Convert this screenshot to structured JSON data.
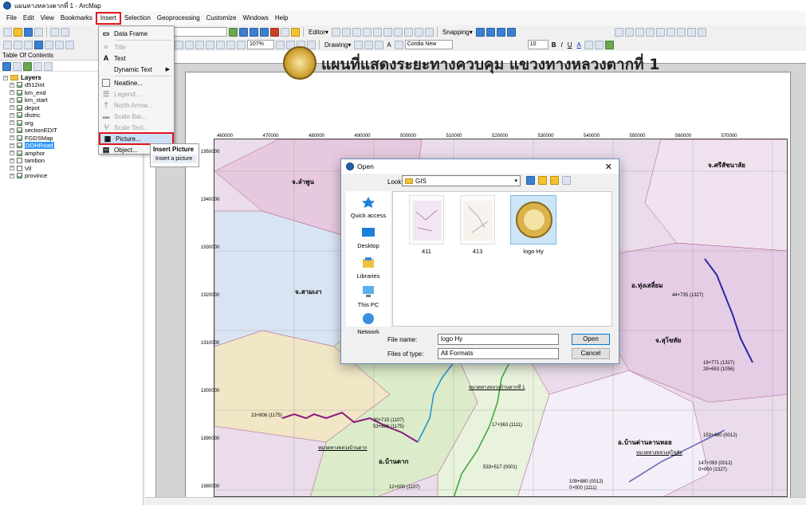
{
  "window": {
    "title": "แผนทางหลวงตากที่ 1 - ArcMap"
  },
  "menu": [
    "File",
    "Edit",
    "View",
    "Bookmarks",
    "Insert",
    "Selection",
    "Geoprocessing",
    "Customize",
    "Windows",
    "Help"
  ],
  "toolbar": {
    "editor_label": "Editor▾",
    "snapping_label": "Snapping▾",
    "drawing_label": "Drawing▾",
    "zoom_value": "107%",
    "font_name": "Cordia New",
    "font_size": "10",
    "bold": "B",
    "italic": "I",
    "underline": "U",
    "font_color": "A"
  },
  "toc": {
    "title": "Table Of Contents",
    "root": "Layers",
    "layers": [
      {
        "name": "d512int",
        "checked": true
      },
      {
        "name": "km_end",
        "checked": true
      },
      {
        "name": "km_start",
        "checked": true
      },
      {
        "name": "depot",
        "checked": true
      },
      {
        "name": "distric",
        "checked": true
      },
      {
        "name": "org",
        "checked": true
      },
      {
        "name": "sectionEDIT",
        "checked": true
      },
      {
        "name": "FGDSMap",
        "checked": true
      },
      {
        "name": "DOHRoad",
        "checked": true,
        "selected": true
      },
      {
        "name": "amphor",
        "checked": true
      },
      {
        "name": "tambon",
        "checked": false
      },
      {
        "name": "Vil",
        "checked": false
      },
      {
        "name": "province",
        "checked": true
      }
    ]
  },
  "insert_menu": {
    "items": [
      {
        "label": "Data Frame",
        "disabled": false
      },
      {
        "label": "Title",
        "disabled": true
      },
      {
        "label": "Text",
        "disabled": false
      },
      {
        "label": "Dynamic Text",
        "disabled": false,
        "submenu": true
      },
      {
        "label": "Neatline...",
        "disabled": false
      },
      {
        "label": "Legend...",
        "disabled": true
      },
      {
        "label": "North Arrow...",
        "disabled": true
      },
      {
        "label": "Scale Bar...",
        "disabled": true
      },
      {
        "label": "Scale Text...",
        "disabled": true
      },
      {
        "label": "Picture...",
        "disabled": false,
        "highlighted": true
      },
      {
        "label": "Object...",
        "disabled": false
      }
    ],
    "tooltip_title": "Insert Picture",
    "tooltip_text": "Insert a picture"
  },
  "map": {
    "title": "แผนที่แสดงระยะทางควบคุม แขวงทางหลวงตากที่ 1",
    "x_ticks": [
      "460000",
      "470000",
      "480000",
      "490000",
      "500000",
      "510000",
      "520000",
      "530000",
      "540000",
      "550000",
      "560000",
      "570000"
    ],
    "y_ticks": [
      "1950000",
      "1940000",
      "1930000",
      "1920000",
      "1910000",
      "1900000",
      "1890000",
      "1880000"
    ],
    "province_labels": [
      "จ.ลำพูน",
      "จ.ศรีสัชนาลัย",
      "จ.สามเงา",
      "อ.ทุ่งเสลี่ยม",
      "จ.สุโขทัย",
      "อ.บ้านตาก",
      "อ.บ้านด่านลานหอย"
    ],
    "road_labels": [
      "44+735 (1327)",
      "19+771 (1327)",
      "28+653 (1056)",
      "23+806 (1175)",
      "30+715 (1107)",
      "53+606 (1175)",
      "17+363 (1111)",
      "153+480 (0012)",
      "147+093 (0012)",
      "0+000 (1327)",
      "12+000 (1107)",
      "109+880 (0012)",
      "0+000 (1111)",
      "533+517 (0001)",
      "หมวดทางหลวงบ้านตาก",
      "หมวดทางหลวงบ้านตากที่ 1",
      "หมวดทางหลวงสุโขทัย"
    ]
  },
  "dialog": {
    "title": "Open",
    "lookin_label": "Look in:",
    "lookin_value": "GIS",
    "places": [
      "Quick access",
      "Desktop",
      "Libraries",
      "This PC",
      "Network"
    ],
    "files": [
      {
        "name": "411",
        "selected": false
      },
      {
        "name": "413",
        "selected": false
      },
      {
        "name": "logo Hy",
        "selected": true
      }
    ],
    "file_name_label": "File name:",
    "file_name_value": "logo Hy",
    "file_type_label": "Files of type:",
    "file_type_value": "All Formats",
    "open_button": "Open",
    "cancel_button": "Cancel"
  }
}
